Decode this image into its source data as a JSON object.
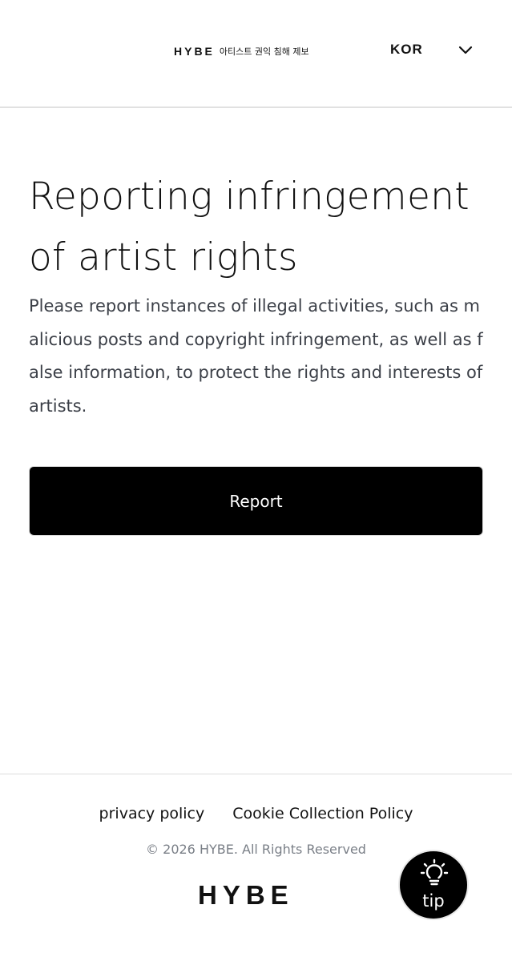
{
  "header": {
    "logo": "HYBE",
    "subtitle": "아티스트 권익 침해 제보",
    "language": "KOR",
    "language_icon": "chevron-down-icon"
  },
  "main": {
    "title": "Reporting infringement of artist rights",
    "description": "Please report instances of illegal activities, such as malicious posts and copyright infringement, as well as false information, to protect the rights and interests of artists.",
    "report_button": "Report"
  },
  "footer": {
    "links": [
      "privacy policy",
      "Cookie Collection Policy"
    ],
    "copyright": "© 2026 HYBE. All Rights Reserved",
    "logo": "HYBE"
  },
  "tip": {
    "label": "tip",
    "icon": "lightbulb-icon"
  },
  "colors": {
    "background": "#ffffff",
    "button": "#000000",
    "button_text": "#ffffff",
    "description_text": "#3b3f47",
    "copyright_text": "#7a7f87",
    "divider": "#e1e1e1"
  }
}
